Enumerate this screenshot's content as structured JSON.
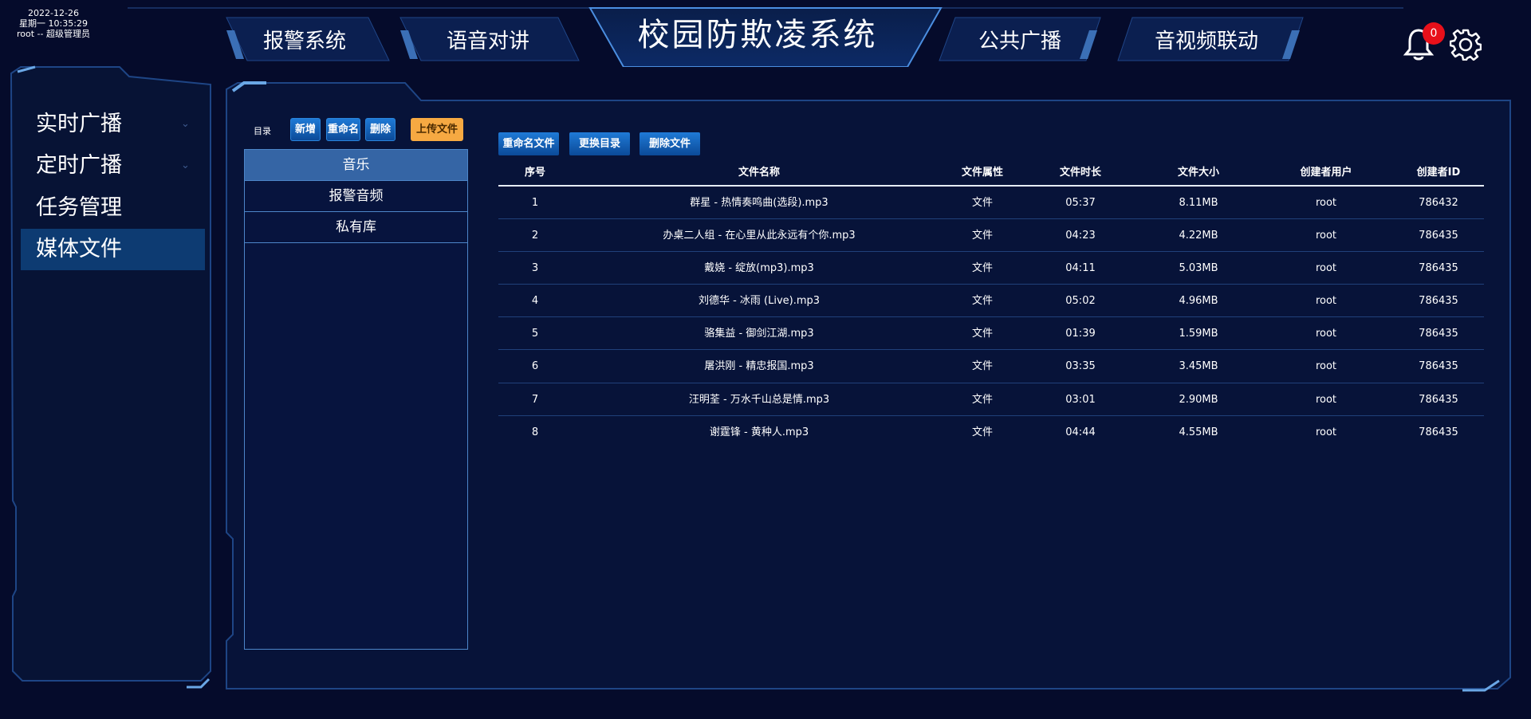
{
  "header": {
    "date": "2022-12-26",
    "time": "星期一 10:35:29",
    "user": "root -- 超级管理员",
    "title": "校园防欺凌系统",
    "nav": [
      "报警系统",
      "语音对讲",
      "公共广播",
      "音视频联动"
    ],
    "notification_count": "0"
  },
  "colors": {
    "background": "#050b2b",
    "accent": "#1f7ad6",
    "upload": "#f6a942",
    "badge": "#e8101a",
    "active_item": "#0d3b72",
    "active_dir": "#3565a5"
  },
  "sidebar": {
    "items": [
      {
        "label": "实时广播",
        "icon": "chevron-down-icon"
      },
      {
        "label": "定时广播",
        "icon": "chevron-down-icon"
      },
      {
        "label": "任务管理"
      },
      {
        "label": "媒体文件",
        "active": true
      }
    ]
  },
  "directory": {
    "label": "目录",
    "buttons": [
      "新增",
      "重命名",
      "删除"
    ],
    "upload": "上传文件",
    "items": [
      "音乐",
      "报警音频",
      "私有库"
    ],
    "selected": "音乐"
  },
  "files": {
    "buttons": [
      "重命名文件",
      "更换目录",
      "删除文件"
    ],
    "columns": [
      "序号",
      "文件名称",
      "文件属性",
      "文件时长",
      "文件大小",
      "创建者用户",
      "创建者ID"
    ],
    "rows": [
      [
        "1",
        "群星 - 热情奏鸣曲(选段).mp3",
        "文件",
        "05:37",
        "8.11MB",
        "root",
        "786432"
      ],
      [
        "2",
        "办桌二人组 - 在心里从此永远有个你.mp3",
        "文件",
        "04:23",
        "4.22MB",
        "root",
        "786435"
      ],
      [
        "3",
        "戴娆 - 绽放(mp3).mp3",
        "文件",
        "04:11",
        "5.03MB",
        "root",
        "786435"
      ],
      [
        "4",
        "刘德华 - 冰雨 (Live).mp3",
        "文件",
        "05:02",
        "4.96MB",
        "root",
        "786435"
      ],
      [
        "5",
        "骆集益 - 御剑江湖.mp3",
        "文件",
        "01:39",
        "1.59MB",
        "root",
        "786435"
      ],
      [
        "6",
        "屠洪刚 - 精忠报国.mp3",
        "文件",
        "03:35",
        "3.45MB",
        "root",
        "786435"
      ],
      [
        "7",
        "汪明荃 - 万水千山总是情.mp3",
        "文件",
        "03:01",
        "2.90MB",
        "root",
        "786435"
      ],
      [
        "8",
        "谢霆锋 - 黄种人.mp3",
        "文件",
        "04:44",
        "4.55MB",
        "root",
        "786435"
      ]
    ]
  }
}
